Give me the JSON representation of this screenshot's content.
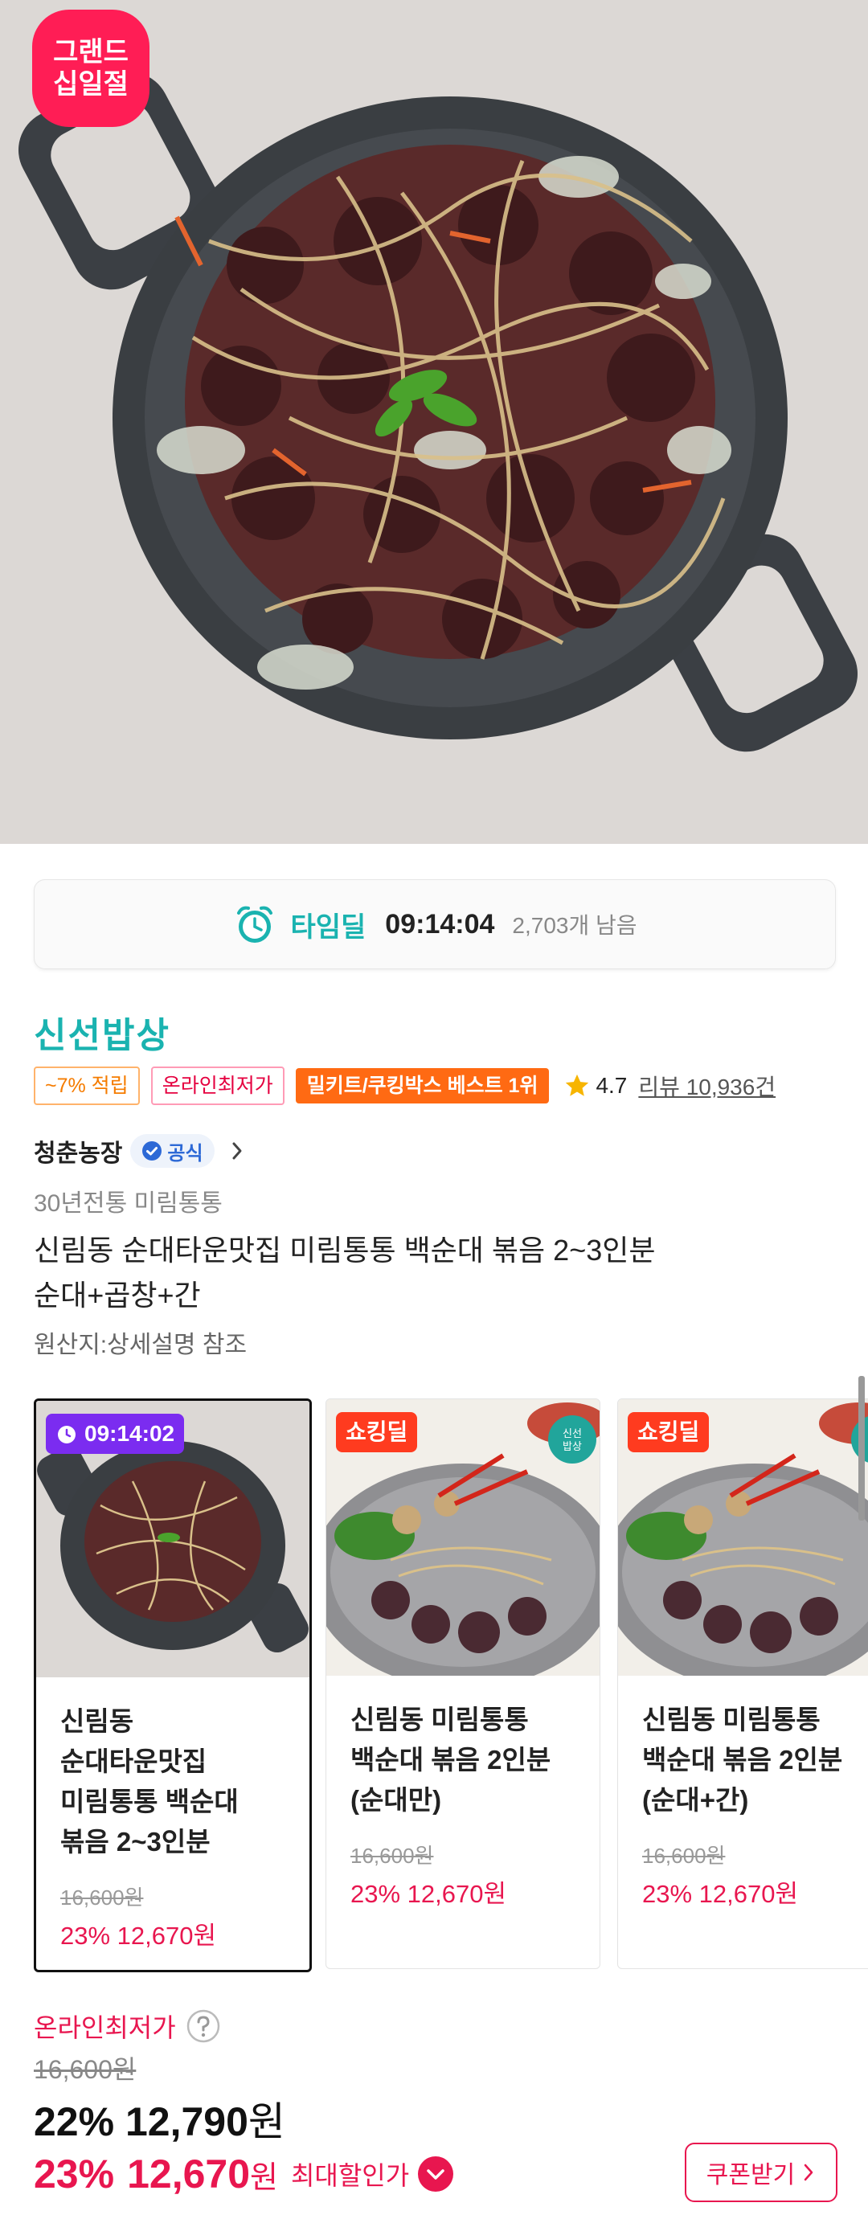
{
  "hero": {
    "badge_line1": "그랜드",
    "badge_line2": "십일절"
  },
  "timedeal": {
    "label": "타임딜",
    "timer": "09:14:04",
    "remaining": "2,703개 남음"
  },
  "brand": "신선밥상",
  "tags": {
    "points": "~7% 적립",
    "lowest": "온라인최저가",
    "best": "밀키트/쿠킹박스 베스트 1위",
    "rating": "4.7",
    "review": "리뷰 10,936건"
  },
  "seller": {
    "name": "청춘농장",
    "official": "공식"
  },
  "product": {
    "subtitle": "30년전통 미림통통",
    "title_line1": "신림동 순대타운맛집 미림통통 백순대 볶음 2~3인분",
    "title_line2": "순대+곱창+간",
    "origin": "원산지:상세설명 참조"
  },
  "options": [
    {
      "badge": "09:14:02",
      "name_lines": [
        "신림동",
        "순대타운맛집",
        "미림통통 백순대",
        "볶음 2~3인분"
      ],
      "orig_price": "16,600원",
      "sale": "23% 12,670원"
    },
    {
      "badge": "쇼킹딜",
      "name_lines": [
        "신림동 미림통통",
        "백순대 볶음 2인분",
        "(순대만)"
      ],
      "orig_price": "16,600원",
      "sale": "23% 12,670원"
    },
    {
      "badge": "쇼킹딜",
      "name_lines": [
        "신림동 미림통통",
        "백순대 볶음 2인분",
        "(순대+간)"
      ],
      "orig_price": "16,600원",
      "sale": "23% 12,670원"
    }
  ],
  "card_stamp": {
    "line1": "신선",
    "line2": "밥상"
  },
  "price": {
    "lowest_label": "온라인최저가",
    "original": "16,600원",
    "discount_pct": "22%",
    "discount_amount": "12,790",
    "won": "원",
    "max_pct": "23%",
    "max_amount": "12,670",
    "max_label": "최대할인가",
    "coupon": "쿠폰받기"
  },
  "colors": {
    "teal": "#1ab3b0",
    "accent_red": "#e8164f",
    "orange": "#ff6a13",
    "purple": "#7b2cf0"
  }
}
